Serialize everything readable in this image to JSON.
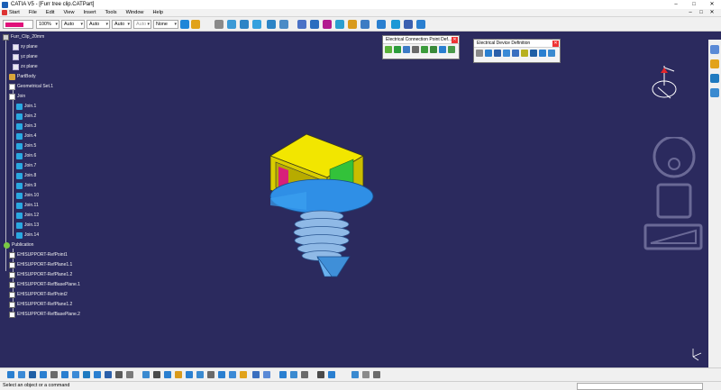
{
  "window": {
    "title": "CATIA V5 - [Furr tree clip.CATPart]",
    "controls": [
      "–",
      "□",
      "✕"
    ]
  },
  "menu": {
    "items": [
      "Start",
      "File",
      "Edit",
      "View",
      "Insert",
      "Tools",
      "Window",
      "Help"
    ],
    "doc_controls": [
      "–",
      "□",
      "✕"
    ]
  },
  "toolbar": {
    "color_swatch": "#e0117a",
    "transparency": "100%",
    "line_thickness": "Auto",
    "line_type": "Auto",
    "point_symbol": "Auto",
    "rendering_style": "Auto",
    "layer": "None"
  },
  "tree": {
    "root": "Furr_Clip_20mm",
    "nodes": [
      {
        "label": "xy plane",
        "icon": "plane-icon"
      },
      {
        "label": "yz plane",
        "icon": "plane-icon"
      },
      {
        "label": "zx plane",
        "icon": "plane-icon"
      },
      {
        "label": "PartBody",
        "icon": "body-icon"
      },
      {
        "label": "Geometrical Set.1",
        "icon": "set-icon"
      },
      {
        "label": "Join",
        "icon": "set-icon"
      },
      {
        "label": "Join.1",
        "icon": "join-icon"
      },
      {
        "label": "Join.2",
        "icon": "join-icon"
      },
      {
        "label": "Join.3",
        "icon": "join-icon"
      },
      {
        "label": "Join.4",
        "icon": "join-icon"
      },
      {
        "label": "Join.5",
        "icon": "join-icon"
      },
      {
        "label": "Join.6",
        "icon": "join-icon"
      },
      {
        "label": "Join.7",
        "icon": "join-icon"
      },
      {
        "label": "Join.8",
        "icon": "join-icon"
      },
      {
        "label": "Join.9",
        "icon": "join-icon"
      },
      {
        "label": "Join.10",
        "icon": "join-icon"
      },
      {
        "label": "Join.11",
        "icon": "join-icon"
      },
      {
        "label": "Join.12",
        "icon": "join-icon"
      },
      {
        "label": "Join.13",
        "icon": "join-icon"
      },
      {
        "label": "Join.14",
        "icon": "join-icon"
      },
      {
        "label": "Publication",
        "icon": "pub-icon"
      },
      {
        "label": "EHISUPPORT-RefPoint1",
        "icon": "sup-icon"
      },
      {
        "label": "EHISUPPORT-RefPlane1.1",
        "icon": "sup-icon"
      },
      {
        "label": "EHISUPPORT-RefPlane1.2",
        "icon": "sup-icon"
      },
      {
        "label": "EHISUPPORT-RefBasePlane.1",
        "icon": "sup-icon"
      },
      {
        "label": "EHISUPPORT-RefPoint2",
        "icon": "sup-icon"
      },
      {
        "label": "EHISUPPORT-RefPlane1.2",
        "icon": "sup-icon"
      },
      {
        "label": "EHISUPPORT-RefBasePlane.2",
        "icon": "sup-icon"
      }
    ]
  },
  "palettes": {
    "connection_point": {
      "title": "Electrical Connection Point Def..."
    },
    "device_definition": {
      "title": "Electrical Device Definition"
    }
  },
  "status": {
    "prompt": "Select an object or a command"
  },
  "colors": {
    "background": "#2b2a5e",
    "part_yellow": "#f2e600",
    "part_blue": "#2f8fe6",
    "part_green": "#33c23a"
  }
}
